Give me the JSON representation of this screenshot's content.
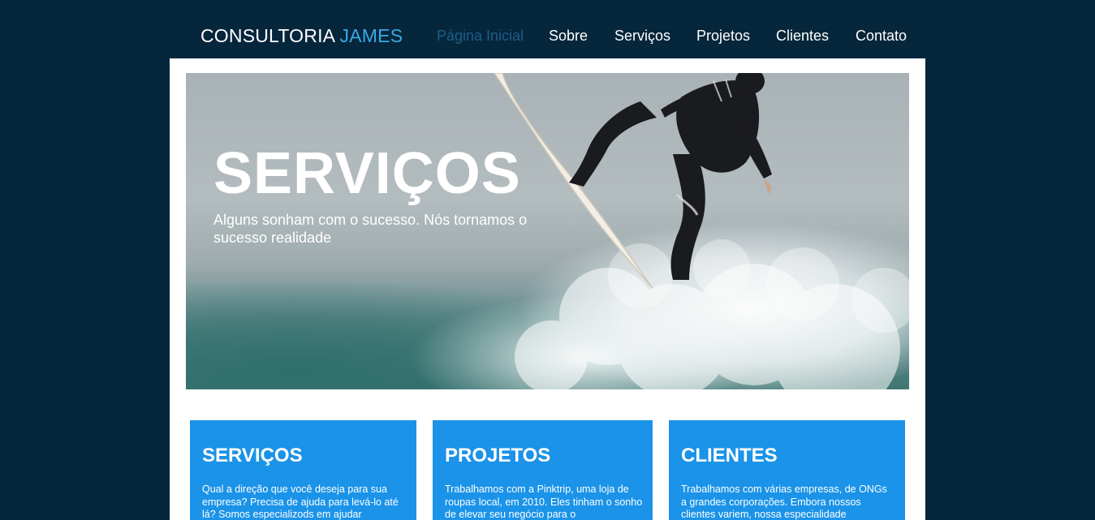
{
  "header": {
    "logo_main": "CONSULTORIA",
    "logo_accent": "JAMES",
    "nav": [
      {
        "label": "Página Inicial",
        "active": true
      },
      {
        "label": "Sobre",
        "active": false
      },
      {
        "label": "Serviços",
        "active": false
      },
      {
        "label": "Projetos",
        "active": false
      },
      {
        "label": "Clientes",
        "active": false
      },
      {
        "label": "Contato",
        "active": false
      }
    ]
  },
  "hero": {
    "title": "SERVIÇOS",
    "subtitle": "Alguns sonham com o sucesso. Nós tornamos o sucesso realidade",
    "image_subject": "surfer-on-wave"
  },
  "cards": [
    {
      "title": "SERVIÇOS",
      "text": "Qual a direção que você deseja para sua empresa? Precisa de ajuda para levá-lo até lá? Somos especializods em ajudar"
    },
    {
      "title": "PROJETOS",
      "text": "Trabalhamos com a Pinktrip, uma loja de roupas local, em 2010. Eles tinham o sonho de elevar seu negócio para o"
    },
    {
      "title": "CLIENTES",
      "text": "Trabalhamos com várias empresas, de ONGs a grandes corporações. Embora nossos clientes variem, nossa especialidade"
    }
  ],
  "colors": {
    "background": "#06263c",
    "accent": "#3aa9e6",
    "nav_active": "#1b5f87",
    "card": "#1a93e8"
  }
}
